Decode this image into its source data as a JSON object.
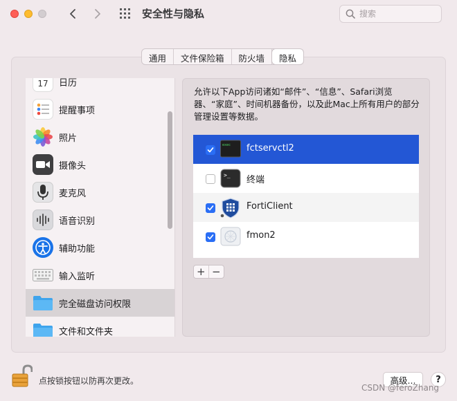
{
  "window": {
    "title": "安全性与隐私"
  },
  "search": {
    "placeholder": "搜索"
  },
  "tabs": [
    {
      "label": "通用",
      "active": false
    },
    {
      "label": "文件保险箱",
      "active": false
    },
    {
      "label": "防火墙",
      "active": false
    },
    {
      "label": "隐私",
      "active": true
    }
  ],
  "sidebar": {
    "items": [
      {
        "label": "日历",
        "icon": "calendar-icon"
      },
      {
        "label": "提醒事项",
        "icon": "reminders-icon"
      },
      {
        "label": "照片",
        "icon": "photos-icon"
      },
      {
        "label": "摄像头",
        "icon": "camera-icon"
      },
      {
        "label": "麦克风",
        "icon": "microphone-icon"
      },
      {
        "label": "语音识别",
        "icon": "speech-recognition-icon"
      },
      {
        "label": "辅助功能",
        "icon": "accessibility-icon"
      },
      {
        "label": "输入监听",
        "icon": "keyboard-icon"
      },
      {
        "label": "完全磁盘访问权限",
        "icon": "folder-icon",
        "selected": true
      },
      {
        "label": "文件和文件夹",
        "icon": "folder-icon"
      }
    ]
  },
  "description": "允许以下App访问诸如“邮件”、“信息”、Safari浏览器、“家庭”、时间机器备份，以及此Mac上所有用户的部分管理设置等数据。",
  "apps": [
    {
      "name": "fctservctl2",
      "checked": true,
      "selected": true,
      "icon": "terminal-exec-icon"
    },
    {
      "name": "终端",
      "checked": false,
      "selected": false,
      "icon": "terminal-icon"
    },
    {
      "name": "FortiClient",
      "checked": true,
      "selected": false,
      "icon": "forticlient-shield-icon"
    },
    {
      "name": "fmon2",
      "checked": true,
      "selected": false,
      "icon": "generic-app-icon"
    }
  ],
  "list_controls": {
    "add": "+",
    "remove": "−"
  },
  "footer": {
    "lock_text": "点按锁按钮以防再次更改。",
    "advanced_label": "高级...",
    "help_label": "?",
    "watermark": "CSDN @feroZhang"
  },
  "colors": {
    "window_bg": "#f1e9ec",
    "selection_blue": "#2357d5",
    "checkbox_blue": "#2a6ef5",
    "close": "#fe5f57",
    "minimize": "#febc2e"
  }
}
